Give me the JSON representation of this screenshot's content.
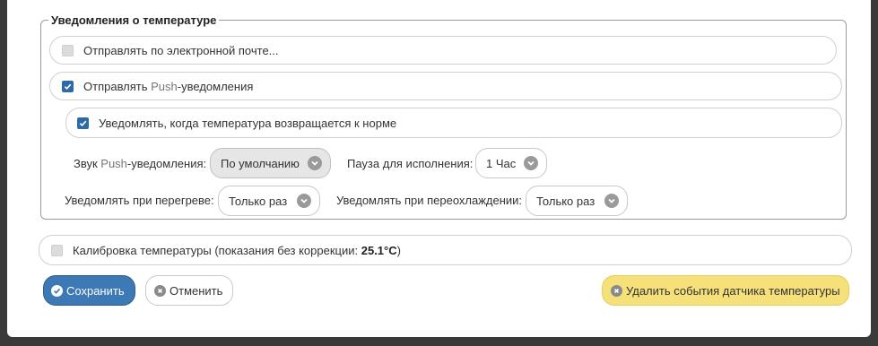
{
  "group": {
    "legend": "Уведомления о температуре"
  },
  "email": {
    "label": "Отправлять по электронной почте...",
    "checked": false
  },
  "push": {
    "label_prefix": "Отправлять ",
    "label_light": "Push",
    "label_suffix": "-уведомления",
    "checked": true
  },
  "normal": {
    "label": "Уведомлять, когда температура возвращается к норме",
    "checked": true
  },
  "push_sound": {
    "label_prefix": "Звук ",
    "label_light": "Push",
    "label_suffix": "-уведомления:",
    "value": "По умолчанию"
  },
  "pause": {
    "label": "Пауза для исполнения:",
    "value": "1 Час"
  },
  "overheat": {
    "label": "Уведомлять при перегреве:",
    "value": "Только раз"
  },
  "overcool": {
    "label": "Уведомлять при переохлаждении:",
    "value": "Только раз"
  },
  "calibration": {
    "label": "Калибровка температуры (показания без коррекции: ",
    "value": "25.1°C",
    "label_end": ")",
    "checked": false
  },
  "buttons": {
    "save": "Сохранить",
    "cancel": "Отменить",
    "delete": "Удалить события датчика температуры"
  }
}
